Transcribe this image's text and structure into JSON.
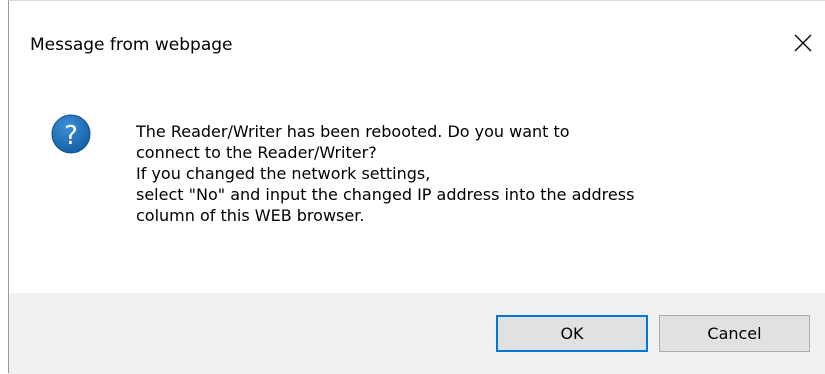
{
  "dialog": {
    "title": "Message from webpage",
    "close_icon": "close-icon",
    "icon": "question-icon",
    "message_lines": [
      "The Reader/Writer has been rebooted. Do you want to",
      "connect to the Reader/Writer?",
      "If you changed the network settings,",
      "select \"No\" and input the changed IP address into the address",
      "column of this WEB browser."
    ],
    "buttons": {
      "ok_label": "OK",
      "cancel_label": "Cancel"
    }
  },
  "colors": {
    "icon_blue": "#1d6fb8",
    "focus_border": "#0078d7",
    "footer_bg": "#f0f0f0",
    "button_bg": "#e1e1e1"
  }
}
